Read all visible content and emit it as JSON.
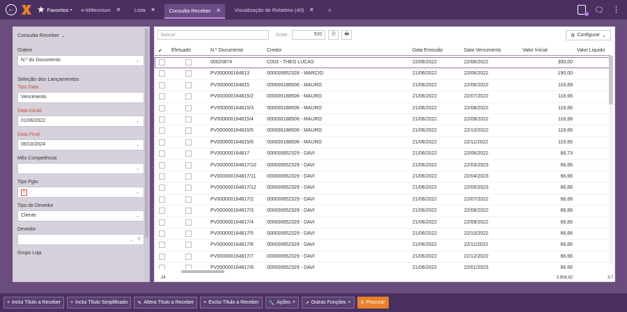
{
  "topbar": {
    "favorites_label": "Favoritos",
    "tabs": [
      {
        "label": "e-Millennium",
        "active": false
      },
      {
        "label": "Lista",
        "active": false
      },
      {
        "label": "Consulta Receber",
        "active": true
      },
      {
        "label": "Visualização de Relatório (40)",
        "active": false
      }
    ]
  },
  "sidebar": {
    "title": "Consulta Receber",
    "ordem_label": "Ordem",
    "ordem_value": "N.º do Documento",
    "section_label": "Seleção dos Lançamentos",
    "tipo_data_label": "Tipo Data",
    "tipo_data_value": "Vencimento",
    "data_inicial_label": "Data Inicial",
    "data_inicial_value": "01/06/2022",
    "data_final_label": "Data Final",
    "data_final_value": "06/10/2024",
    "mes_comp_label": "Mês Competência",
    "mes_comp_value": "",
    "tipo_pgto_label": "Tipo Pgto",
    "tipo_pgto_chip": "x",
    "tipo_devedor_label": "Tipo de Devedor",
    "tipo_devedor_value": "Cliente",
    "devedor_label": "Devedor",
    "grupo_loja_label": "Grupo Loja"
  },
  "main": {
    "search_placeholder": "buscar",
    "limit_label": "limite:",
    "limit_value": "500",
    "config_label": "Configurar",
    "columns": [
      "Efetuado",
      "N.º Documento",
      "Credor",
      "Data Emissão",
      "Data Vencimento",
      "Valor Inicial",
      "Valor Liquido"
    ],
    "rows": [
      {
        "doc": "00020874",
        "credor": "C003 - THEO LUCAS",
        "emissao": "22/06/2022",
        "venc": "22/06/2022",
        "valor": "300,00"
      },
      {
        "doc": "PV000000164813",
        "credor": "000000652328 - MARCIO",
        "emissao": "21/06/2022",
        "venc": "22/06/2022",
        "valor": "190,00"
      },
      {
        "doc": "PV000000164815",
        "credor": "000000188506 - MAURO",
        "emissao": "21/06/2022",
        "venc": "22/06/2022",
        "valor": "116,69"
      },
      {
        "doc": "PV000000164815/2",
        "credor": "000000188506 - MAURO",
        "emissao": "21/06/2022",
        "venc": "22/07/2022",
        "valor": "116,66"
      },
      {
        "doc": "PV000000164815/3",
        "credor": "000000188506 - MAURO",
        "emissao": "21/06/2022",
        "venc": "22/08/2022",
        "valor": "116,66"
      },
      {
        "doc": "PV000000164815/4",
        "credor": "000000188506 - MAURO",
        "emissao": "21/06/2022",
        "venc": "22/09/2022",
        "valor": "116,66"
      },
      {
        "doc": "PV000000164815/5",
        "credor": "000000188506 - MAURO",
        "emissao": "21/06/2022",
        "venc": "22/10/2022",
        "valor": "116,66"
      },
      {
        "doc": "PV000000164815/6",
        "credor": "000000188506 - MAURO",
        "emissao": "21/06/2022",
        "venc": "22/11/2022",
        "valor": "116,66"
      },
      {
        "doc": "PV000000164817",
        "credor": "000000652329 - DAVI",
        "emissao": "21/06/2022",
        "venc": "22/06/2022",
        "valor": "66,73"
      },
      {
        "doc": "PV000000164817/10",
        "credor": "000000652329 - DAVI",
        "emissao": "21/06/2022",
        "venc": "22/03/2023",
        "valor": "66,66"
      },
      {
        "doc": "PV000000164817/11",
        "credor": "000000652329 - DAVI",
        "emissao": "21/06/2022",
        "venc": "22/04/2023",
        "valor": "66,66"
      },
      {
        "doc": "PV000000164817/12",
        "credor": "000000652329 - DAVI",
        "emissao": "21/06/2022",
        "venc": "22/05/2023",
        "valor": "66,66"
      },
      {
        "doc": "PV000000164817/2",
        "credor": "000000652329 - DAVI",
        "emissao": "21/06/2022",
        "venc": "22/07/2022",
        "valor": "66,66"
      },
      {
        "doc": "PV000000164817/3",
        "credor": "000000652329 - DAVI",
        "emissao": "21/06/2022",
        "venc": "22/08/2022",
        "valor": "66,66"
      },
      {
        "doc": "PV000000164817/4",
        "credor": "000000652329 - DAVI",
        "emissao": "21/06/2022",
        "venc": "22/09/2022",
        "valor": "66,66"
      },
      {
        "doc": "PV000000164817/5",
        "credor": "000000652329 - DAVI",
        "emissao": "21/06/2022",
        "venc": "22/10/2022",
        "valor": "66,66"
      },
      {
        "doc": "PV000000164817/6",
        "credor": "000000652329 - DAVI",
        "emissao": "21/06/2022",
        "venc": "22/11/2022",
        "valor": "66,66"
      },
      {
        "doc": "PV000000164817/7",
        "credor": "000000652329 - DAVI",
        "emissao": "21/06/2022",
        "venc": "22/12/2022",
        "valor": "66,66"
      },
      {
        "doc": "PV000000164817/8",
        "credor": "000000652329 - DAVI",
        "emissao": "21/06/2022",
        "venc": "22/01/2023",
        "valor": "66,66"
      }
    ],
    "footer_count": "24",
    "footer_total": "3.908,92",
    "footer_total2": "3.7"
  },
  "bottombar": {
    "buttons": [
      "Inclui Título a Receber",
      "Inclui Título Simplificado",
      "Altera Título a Receber",
      "Exclui Título a Receber",
      "Ações",
      "Outras Funções",
      "Procurar"
    ]
  }
}
